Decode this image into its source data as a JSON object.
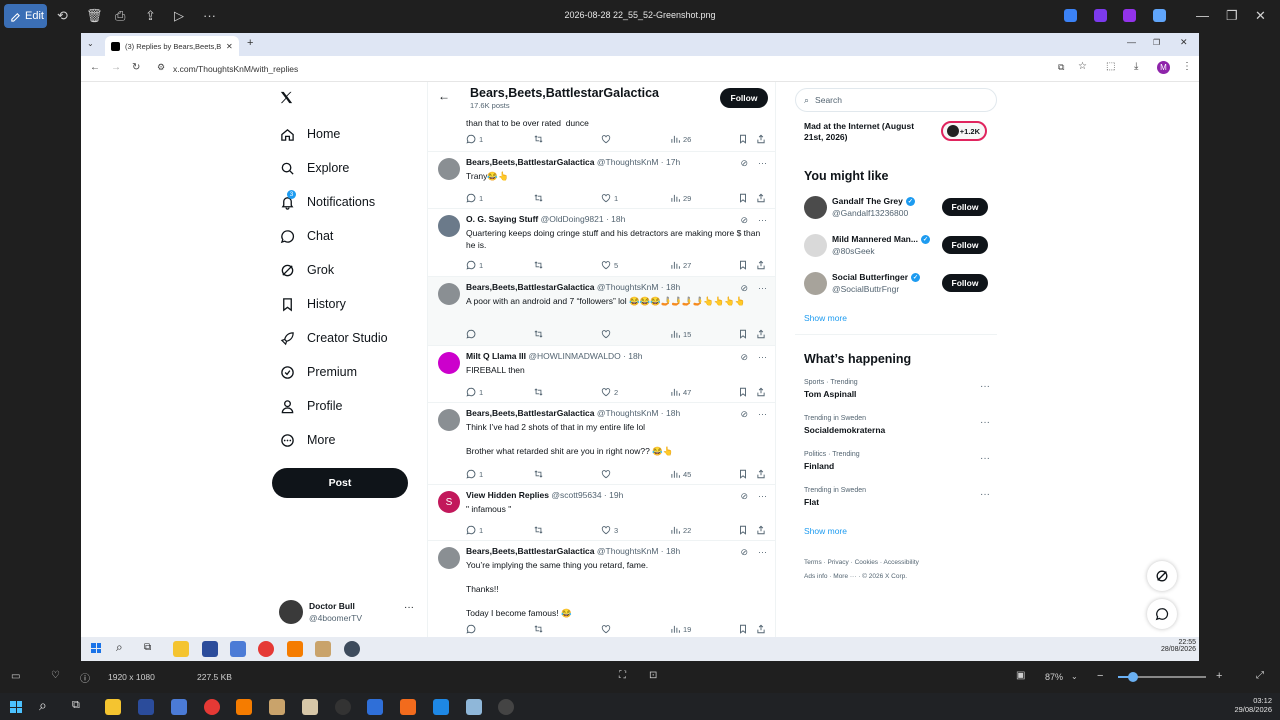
{
  "viewer": {
    "edit_label": "Edit",
    "file_title": "2026-08-28 22_55_52-Greenshot.png",
    "image_dims": "1920 x 1080",
    "file_size": "227.5 KB",
    "zoom": "87%"
  },
  "browser": {
    "tab_title": "(3) Replies by Bears,Beets,Battle",
    "url": "x.com/ThoughtsKnM/with_replies",
    "profile_initial": "M"
  },
  "nav": {
    "items": [
      {
        "label": "Home",
        "icon": "home-icon"
      },
      {
        "label": "Explore",
        "icon": "search-icon"
      },
      {
        "label": "Notifications",
        "icon": "bell-icon",
        "badge": "3"
      },
      {
        "label": "Chat",
        "icon": "chat-icon"
      },
      {
        "label": "Grok",
        "icon": "grok-icon"
      },
      {
        "label": "History",
        "icon": "bookmark-icon"
      },
      {
        "label": "Creator Studio",
        "icon": "rocket-icon"
      },
      {
        "label": "Premium",
        "icon": "verified-icon"
      },
      {
        "label": "Profile",
        "icon": "person-icon"
      },
      {
        "label": "More",
        "icon": "more-circle-icon"
      }
    ],
    "post_label": "Post",
    "user_name": "Doctor Bull",
    "user_handle": "@4boomerTV"
  },
  "profile_header": {
    "name": "Bears,Beets,BattlestarGalactica",
    "posts": "17.6K posts",
    "follow_label": "Follow"
  },
  "tweets": [
    {
      "text": "than that to be over rated  dunce",
      "replies": "1",
      "likes": "",
      "views": "26"
    },
    {
      "name": "Bears,Beets,BattlestarGalactica",
      "handle": "@ThoughtsKnM · 17h",
      "text": "Trany😂👆",
      "replies": "1",
      "likes": "1",
      "views": "29"
    },
    {
      "name": "O. G. Saying Stuff",
      "handle": "@OldDoing9821 · 18h",
      "text": "Quartering keeps doing cringe stuff and his detractors are making more $ than he is.",
      "replies": "1",
      "likes": "5",
      "views": "27"
    },
    {
      "name": "Bears,Beets,BattlestarGalactica",
      "handle": "@ThoughtsKnM · 18h",
      "text": "A poor with an android and 7 “followers” lol 😂😂😂🤳🤳🤳🤳👆👆👆👆",
      "replies": "",
      "likes": "",
      "views": "15"
    },
    {
      "name": "Milt Q Llama III",
      "handle": "@HOWLINMADWALDO · 18h",
      "text": "FIREBALL then",
      "replies": "1",
      "likes": "2",
      "views": "47"
    },
    {
      "name": "Bears,Beets,BattlestarGalactica",
      "handle": "@ThoughtsKnM · 18h",
      "text": "Think I’ve had 2 shots of that in my entire life lol\n\nBrother what retarded shit are you in right now?? 😂👆",
      "replies": "1",
      "likes": "",
      "views": "45"
    },
    {
      "name": "View Hidden Replies",
      "handle": "@scott95634 · 19h",
      "text": "\" infamous \"",
      "replies": "1",
      "likes": "3",
      "views": "22",
      "avatar_letter": "S"
    },
    {
      "name": "Bears,Beets,BattlestarGalactica",
      "handle": "@ThoughtsKnM · 18h",
      "text": "You’re implying the same thing you retard, fame.\n\nThanks!!\n\nToday I become famous! 😂",
      "replies": "",
      "likes": "",
      "views": "19"
    }
  ],
  "right": {
    "search_placeholder": "Search",
    "event_title": "Mad at the Internet (August 21st, 2026)",
    "event_count": "+1.2K",
    "you_might_like": "You might like",
    "suggestions": [
      {
        "name": "Gandalf The Grey",
        "handle": "@Gandalf13236800",
        "follow": "Follow"
      },
      {
        "name": "Mild Mannered Man...",
        "handle": "@80sGeek",
        "follow": "Follow"
      },
      {
        "name": "Social Butterfinger",
        "handle": "@SocialButtrFngr",
        "follow": "Follow"
      }
    ],
    "show_more": "Show more",
    "whats_happening": "What’s happening",
    "trends": [
      {
        "cat": "Sports · Trending",
        "title": "Tom Aspinall"
      },
      {
        "cat": "Trending in Sweden",
        "title": "Socialdemokraterna"
      },
      {
        "cat": "Politics · Trending",
        "title": "Finland"
      },
      {
        "cat": "Trending in Sweden",
        "title": "Flat"
      }
    ],
    "footer1": [
      "Terms",
      "Privacy",
      "Cookies",
      "Accessibility"
    ],
    "footer2": [
      "Ads info",
      "More ···",
      "© 2026 X Corp."
    ]
  },
  "clock_inner": {
    "time": "22:55",
    "date": "28/08/2026"
  },
  "clock_outer": {
    "time": "03:12",
    "date": "29/08/2026"
  }
}
